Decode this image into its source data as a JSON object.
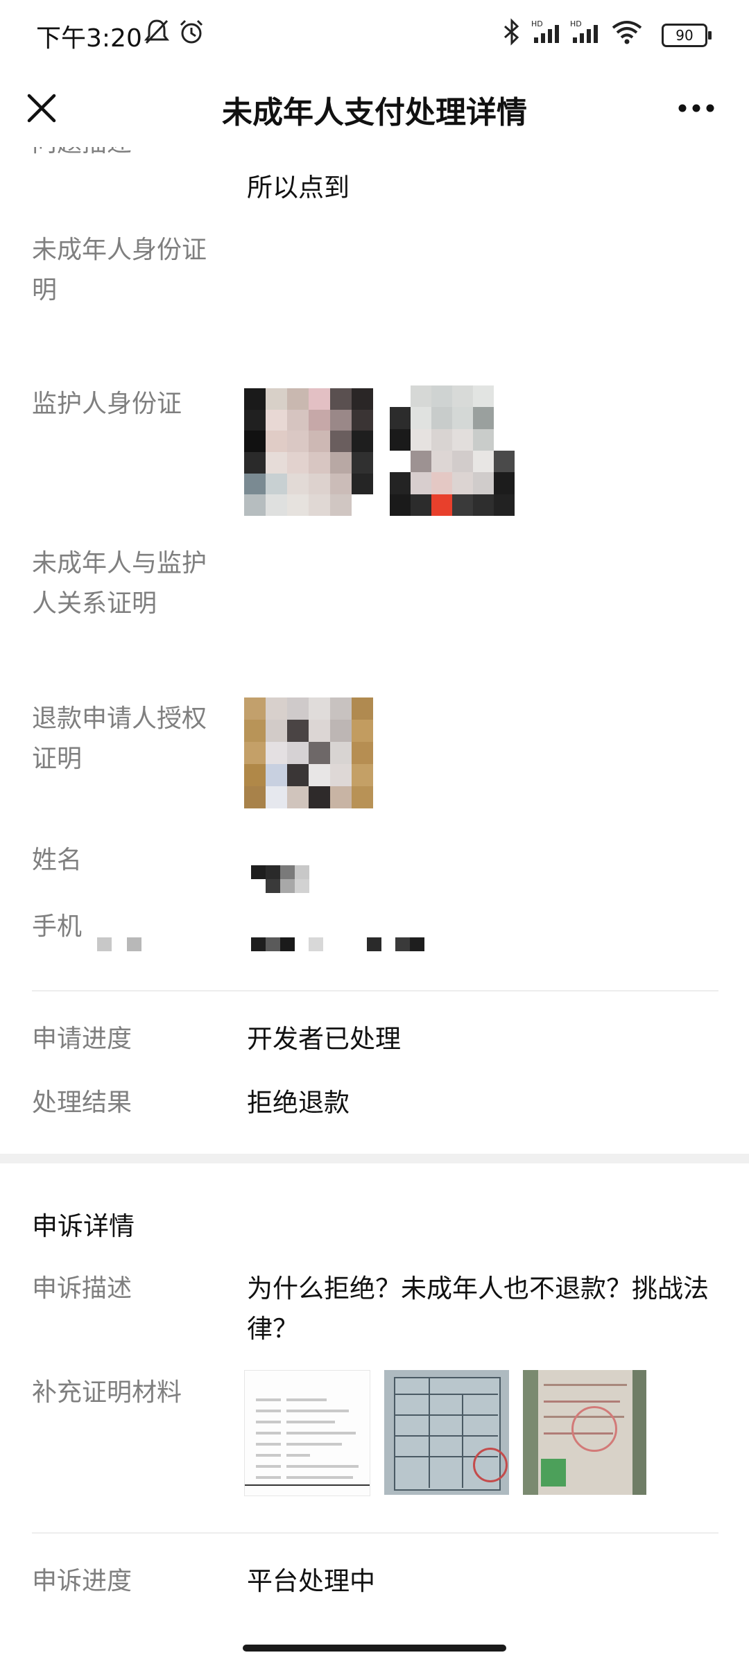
{
  "status_bar": {
    "time": "下午3:20",
    "battery": "90",
    "icons": [
      "mute-icon",
      "alarm-icon",
      "bluetooth-icon",
      "hd-signal-icon",
      "hd-signal-icon",
      "wifi-icon",
      "battery-icon"
    ]
  },
  "header": {
    "title": "未成年人支付处理详情",
    "close_icon": "close-icon",
    "more_icon": "more-icon"
  },
  "details": {
    "problem_label_cut": "问题描述",
    "problem_value_tail": "所以点到",
    "minor_id_label": "未成年人身份证明",
    "guardian_id_label": "监护人身份证",
    "relation_label": "未成年人与监护人关系证明",
    "authorization_label": "退款申请人授权证明",
    "name_label": "姓名",
    "phone_label": "手机"
  },
  "status": {
    "progress_label": "申请进度",
    "progress_value": "开发者已处理",
    "result_label": "处理结果",
    "result_value": "拒绝退款"
  },
  "appeal": {
    "section_title": "申诉详情",
    "description_label": "申诉描述",
    "description_value": "为什么拒绝？未成年人也不退款？挑战法律？",
    "materials_label": "补充证明材料",
    "progress_label": "申诉进度",
    "progress_value": "平台处理中"
  },
  "colors": {
    "label_gray": "#7f7f7f",
    "text": "#111111",
    "divider": "#ededed",
    "section_bg": "#f0f0f0"
  }
}
